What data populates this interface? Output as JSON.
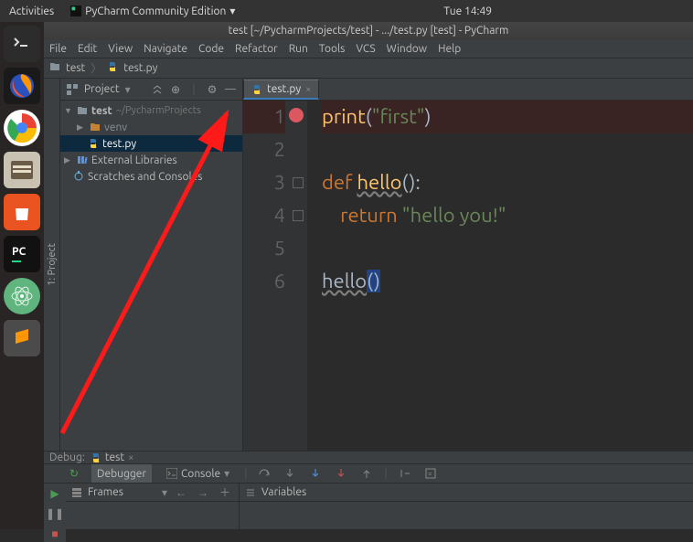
{
  "os": {
    "activities": "Activities",
    "app_name": "PyCharm Community Edition",
    "clock": "Tue 14:49"
  },
  "launcher": {
    "apps": [
      {
        "name": "terminal",
        "bg": "#2c2c2c"
      },
      {
        "name": "firefox",
        "bg": "#1a1a1a"
      },
      {
        "name": "chrome",
        "bg": "#ffffff"
      },
      {
        "name": "files",
        "bg": "#d9c9b3"
      },
      {
        "name": "software",
        "bg": "#e95420"
      },
      {
        "name": "pycharm",
        "bg": "#111"
      },
      {
        "name": "atom",
        "bg": "#5fb57d"
      },
      {
        "name": "sublime",
        "bg": "#4b4b4b"
      }
    ]
  },
  "window": {
    "title": "test [~/PycharmProjects/test] - .../test.py [test] - PyCharm"
  },
  "menu": [
    "File",
    "Edit",
    "View",
    "Navigate",
    "Code",
    "Refactor",
    "Run",
    "Tools",
    "VCS",
    "Window",
    "Help"
  ],
  "breadcrumb": {
    "project": "test",
    "file": "test.py"
  },
  "project_tool": {
    "title": "Project",
    "vtab": "1: Project",
    "tree": {
      "root": {
        "name": "test",
        "path": "~/PycharmProjects"
      },
      "venv": "venv",
      "selected_file": "test.py",
      "ext_libs": "External Libraries",
      "scratches": "Scratches and Consoles"
    }
  },
  "editor": {
    "tab_label": "test.py",
    "code_lines": [
      {
        "n": "1",
        "tokens": [
          [
            "fn",
            "print"
          ],
          [
            "pn",
            "("
          ],
          [
            "str",
            "\"first\""
          ],
          [
            "pn",
            ")"
          ]
        ],
        "breakpoint": true
      },
      {
        "n": "2",
        "tokens": []
      },
      {
        "n": "3",
        "tokens": [
          [
            "kw",
            "def "
          ],
          [
            "def",
            "hello"
          ],
          [
            "pn",
            "():"
          ]
        ],
        "fold": true
      },
      {
        "n": "4",
        "tokens": [
          [
            "pn",
            "    "
          ],
          [
            "kw",
            "return "
          ],
          [
            "str",
            "\"hello you!\""
          ]
        ],
        "fold": true
      },
      {
        "n": "5",
        "tokens": []
      },
      {
        "n": "6",
        "tokens": [
          [
            "idw",
            "hello"
          ],
          [
            "pnhl",
            "()"
          ]
        ]
      }
    ]
  },
  "debug": {
    "label": "Debug:",
    "run_config": "test",
    "tabs": {
      "debugger": "Debugger",
      "console": "Console"
    },
    "frames_title": "Frames",
    "vars_title": "Variables"
  }
}
